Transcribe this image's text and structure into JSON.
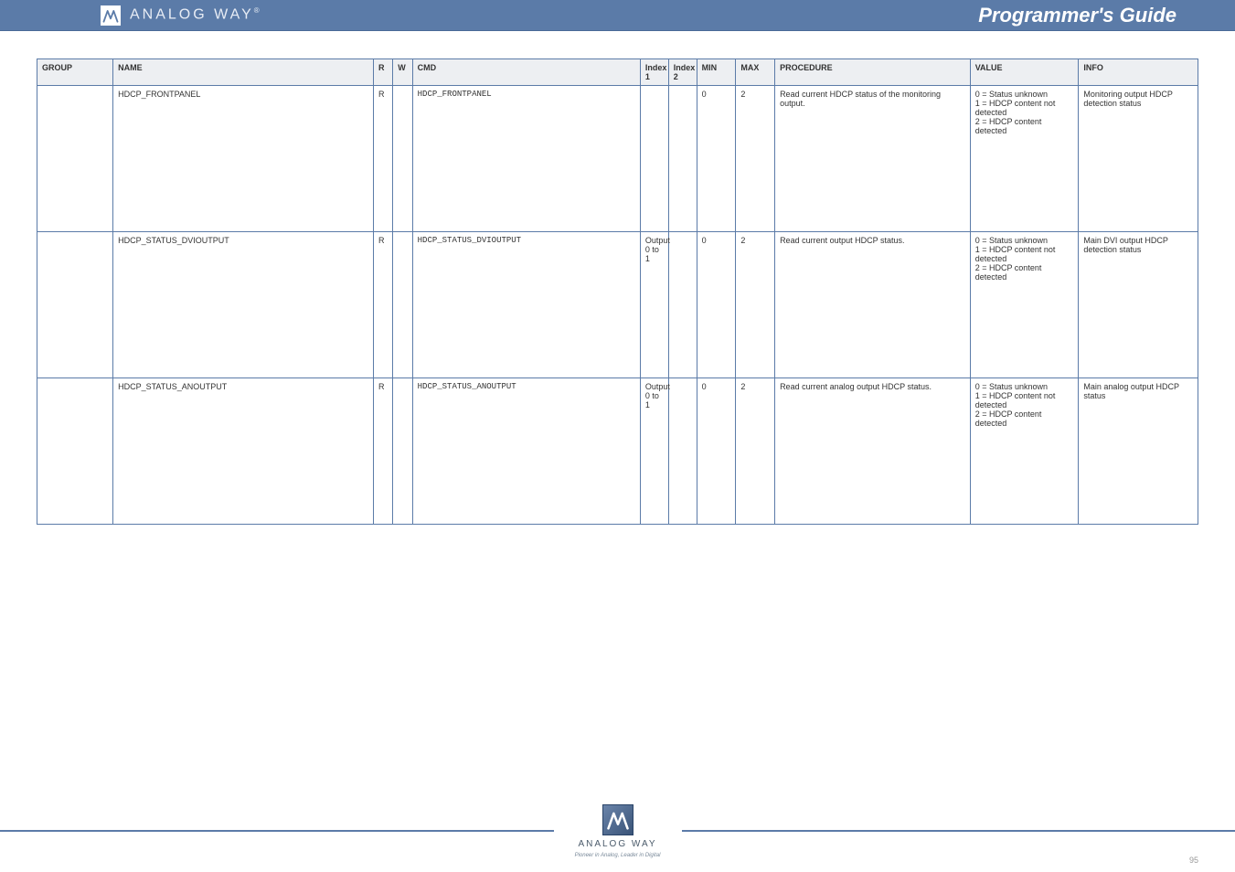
{
  "header": {
    "brand": "ANALOG WAY",
    "brand_reg": "®",
    "title": "Programmer's Guide"
  },
  "table": {
    "columns": [
      "GROUP",
      "NAME",
      "R",
      "W",
      "CMD",
      "Index 1",
      "Index 2",
      "MIN",
      "MAX",
      "PROCEDURE",
      "VALUE",
      "INFO"
    ],
    "rows": [
      {
        "group": "",
        "name": "HDCP_FRONTPANEL",
        "r": "R",
        "w": "",
        "cmd": "HDCP_FRONTPANEL",
        "idx1": "",
        "idx2": "",
        "min": "0",
        "max": "2",
        "proc": "Read current HDCP status of the monitoring output.",
        "value": "0 = Status unknown\n1 = HDCP content not detected\n2 = HDCP content detected",
        "info": "Monitoring output HDCP detection status"
      },
      {
        "group": "",
        "name": "HDCP_STATUS_DVIOUTPUT",
        "r": "R",
        "w": "",
        "cmd": "HDCP_STATUS_DVIOUTPUT",
        "idx1": "Output 0 to 1",
        "idx2": "",
        "min": "0",
        "max": "2",
        "proc": "Read current output HDCP status.",
        "value": "0 = Status unknown\n1 = HDCP content not detected\n2 = HDCP content detected",
        "info": "Main DVI output HDCP detection status"
      },
      {
        "group": "",
        "name": "HDCP_STATUS_ANOUTPUT",
        "r": "R",
        "w": "",
        "cmd": "HDCP_STATUS_ANOUTPUT",
        "idx1": "Output 0 to 1",
        "idx2": "",
        "min": "0",
        "max": "2",
        "proc": "Read current analog output HDCP status.",
        "value": "0 = Status unknown\n1 = HDCP content not detected\n2 = HDCP content detected",
        "info": "Main analog output HDCP status"
      }
    ]
  },
  "footer": {
    "brand": "ANALOG WAY",
    "tagline": "Pioneer in Analog, Leader in Digital",
    "page": "95"
  }
}
